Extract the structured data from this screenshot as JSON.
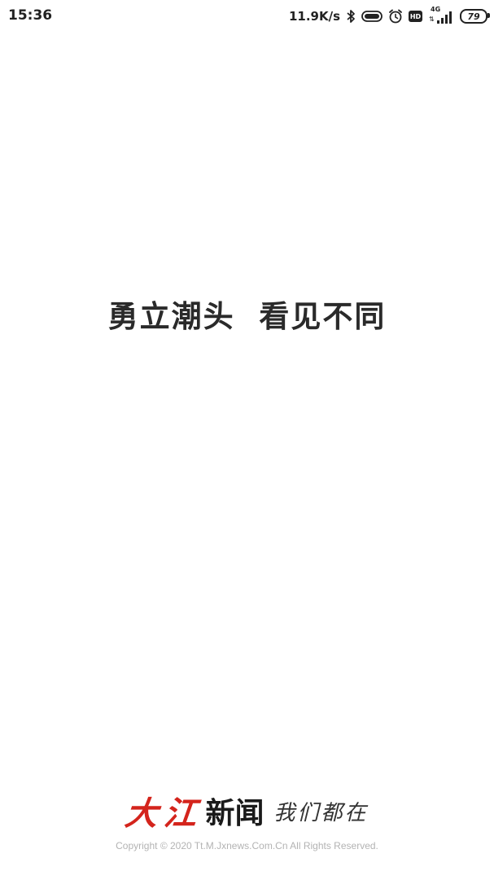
{
  "status_bar": {
    "time": "15:36",
    "net_speed": "11.9K/s",
    "hd_label": "HD",
    "network_type": "4G",
    "battery_level": "79",
    "icons": [
      "bluetooth-icon",
      "toggle-icon",
      "alarm-icon",
      "hd-icon",
      "signal-icon",
      "battery-icon"
    ]
  },
  "slogan": "勇立潮头  看见不同",
  "footer": {
    "brand_red": "大江",
    "brand_black": "新闻",
    "tagline": "我们都在",
    "copyright": "Copyright © 2020 Tt.M.Jxnews.Com.Cn All Rights Reserved.",
    "brand_color": "#d4241c"
  }
}
